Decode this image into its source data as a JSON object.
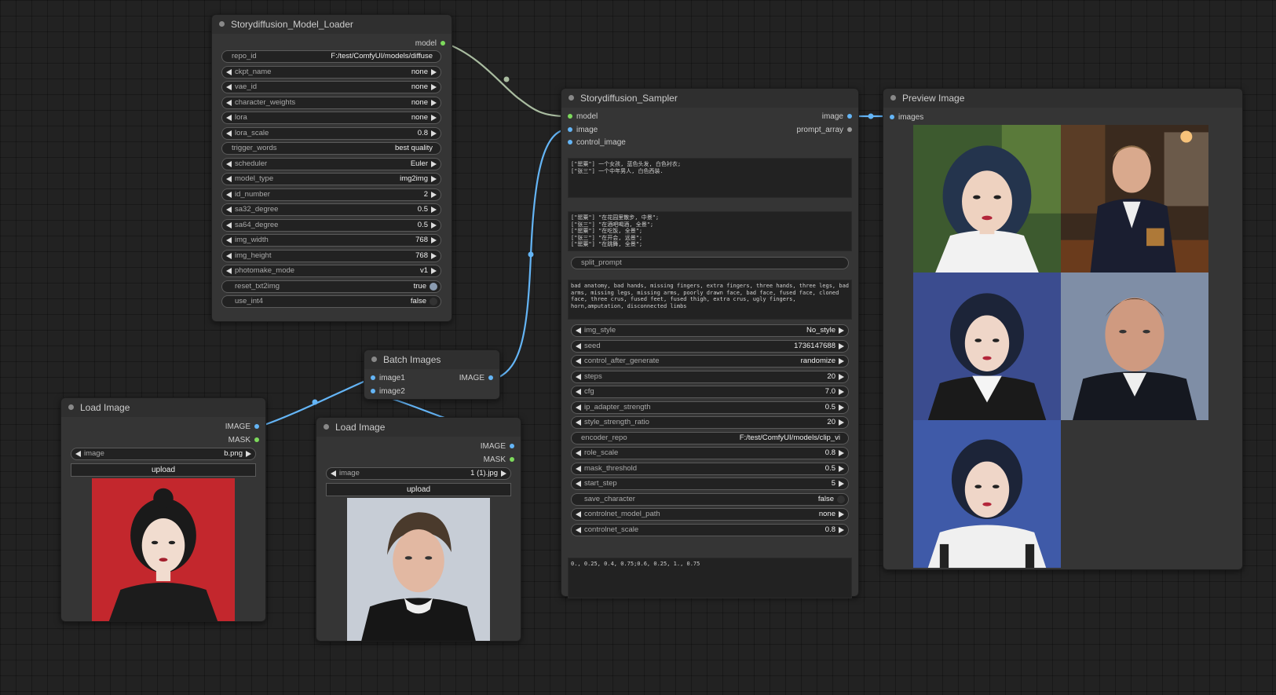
{
  "model_loader": {
    "title": "Storydiffusion_Model_Loader",
    "output_model": "model",
    "widgets": [
      {
        "label": "repo_id",
        "value": "F:/test/ComfyUI/models/diffuse",
        "kind": "text"
      },
      {
        "label": "ckpt_name",
        "value": "none",
        "kind": "combo"
      },
      {
        "label": "vae_id",
        "value": "none",
        "kind": "combo"
      },
      {
        "label": "character_weights",
        "value": "none",
        "kind": "combo"
      },
      {
        "label": "lora",
        "value": "none",
        "kind": "combo"
      },
      {
        "label": "lora_scale",
        "value": "0.8",
        "kind": "number"
      },
      {
        "label": "trigger_words",
        "value": "best quality",
        "kind": "text"
      },
      {
        "label": "scheduler",
        "value": "Euler",
        "kind": "combo"
      },
      {
        "label": "model_type",
        "value": "img2img",
        "kind": "combo"
      },
      {
        "label": "id_number",
        "value": "2",
        "kind": "number"
      },
      {
        "label": "sa32_degree",
        "value": "0.5",
        "kind": "number"
      },
      {
        "label": "sa64_degree",
        "value": "0.5",
        "kind": "number"
      },
      {
        "label": "img_width",
        "value": "768",
        "kind": "number"
      },
      {
        "label": "img_height",
        "value": "768",
        "kind": "number"
      },
      {
        "label": "photomake_mode",
        "value": "v1",
        "kind": "combo"
      },
      {
        "label": "reset_txt2img",
        "value": "true",
        "kind": "toggle"
      },
      {
        "label": "use_int4",
        "value": "false",
        "kind": "toggle"
      }
    ]
  },
  "sampler": {
    "title": "Storydiffusion_Sampler",
    "inputs": [
      "model",
      "image",
      "control_image"
    ],
    "outputs": [
      "image",
      "prompt_array"
    ],
    "character_prompt": "[\"罂粟\"] 一个女孩, 蓝色头发, 白色衬衣;\n[\"张三\"] 一个中年男人, 白色西装.",
    "scene_prompt": "[\"罂粟\"] \"在花园里散步, 中景\";\n[\"张三\"] \"在酒吧喝酒, 全景\";\n[\"罂粟\"] \"在吃饭, 全景\";\n[\"张三\"] \"在开会, 远景\";\n[\"罂粟\"] \"在跳舞, 全景\";",
    "split_prompt_label": "split_prompt",
    "negative_prompt": "bad anatomy, bad hands, missing fingers, extra fingers, three hands, three legs, bad arms, missing legs, missing arms, poorly drawn face, bad face, fused face, cloned face, three crus, fused feet, fused thigh, extra crus, ugly fingers, horn,amputation, disconnected limbs",
    "widgets": [
      {
        "label": "img_style",
        "value": "No_style",
        "kind": "combo"
      },
      {
        "label": "seed",
        "value": "1736147688",
        "kind": "number"
      },
      {
        "label": "control_after_generate",
        "value": "randomize",
        "kind": "combo"
      },
      {
        "label": "steps",
        "value": "20",
        "kind": "number"
      },
      {
        "label": "cfg",
        "value": "7.0",
        "kind": "number"
      },
      {
        "label": "ip_adapter_strength",
        "value": "0.5",
        "kind": "number"
      },
      {
        "label": "style_strength_ratio",
        "value": "20",
        "kind": "number"
      },
      {
        "label": "encoder_repo",
        "value": "F:/test/ComfyUI/models/clip_vi",
        "kind": "text"
      },
      {
        "label": "role_scale",
        "value": "0.8",
        "kind": "number"
      },
      {
        "label": "mask_threshold",
        "value": "0.5",
        "kind": "number"
      },
      {
        "label": "start_step",
        "value": "5",
        "kind": "number"
      },
      {
        "label": "save_character",
        "value": "false",
        "kind": "toggle"
      },
      {
        "label": "controlnet_model_path",
        "value": "none",
        "kind": "combo"
      },
      {
        "label": "controlnet_scale",
        "value": "0.8",
        "kind": "number"
      }
    ],
    "guidance_list": "0., 0.25, 0.4, 0.75;0.6, 0.25, 1., 0.75"
  },
  "preview": {
    "title": "Preview Image",
    "input": "images"
  },
  "batch": {
    "title": "Batch Images",
    "inputs": [
      "image1",
      "image2"
    ],
    "output": "IMAGE"
  },
  "load_image_1": {
    "title": "Load Image",
    "outputs": [
      "IMAGE",
      "MASK"
    ],
    "image_label": "image",
    "image_value": "b.png",
    "upload_label": "upload"
  },
  "load_image_2": {
    "title": "Load Image",
    "outputs": [
      "IMAGE",
      "MASK"
    ],
    "image_label": "image",
    "image_value": "1 (1).jpg",
    "upload_label": "upload"
  },
  "colors": {
    "model_wire": "#a9bca0",
    "image_wire": "#64b5f6",
    "model_slot": "#7dda5c",
    "image_slot": "#64b5f6"
  }
}
